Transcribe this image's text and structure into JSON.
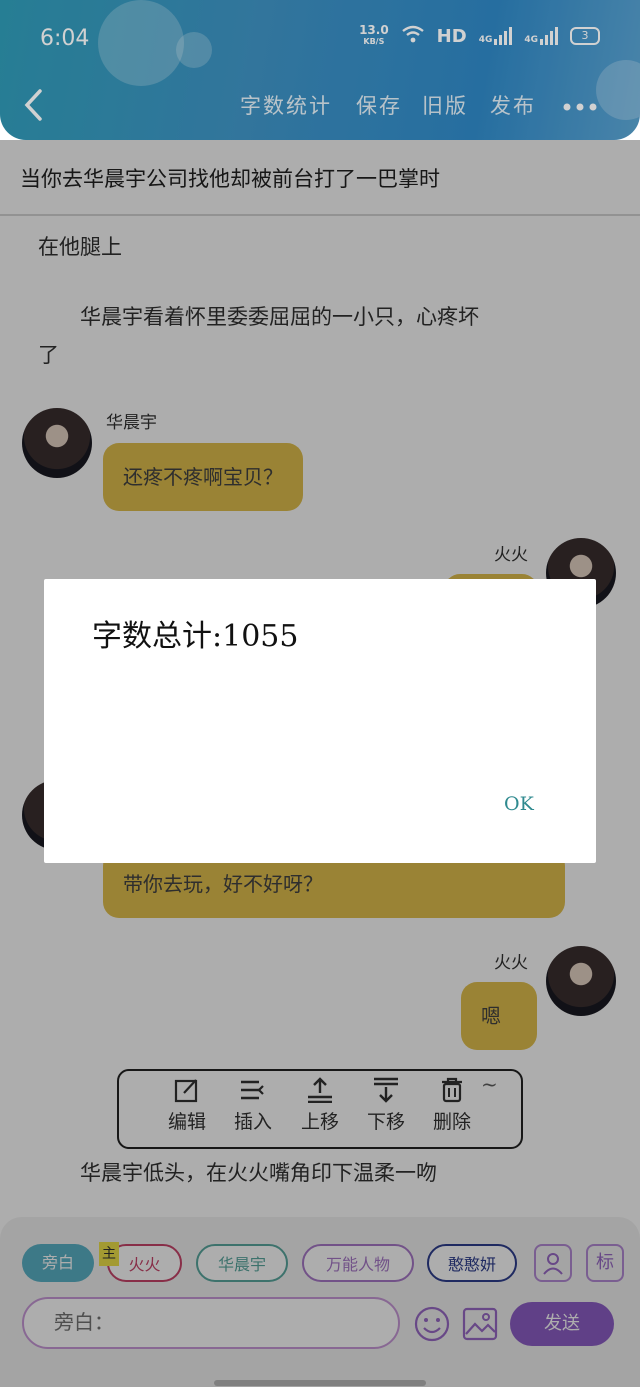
{
  "status_bar": {
    "time": "6:04",
    "net_speed": "13.0",
    "net_unit": "KB/S",
    "hd": "HD",
    "net1": "4G",
    "net2": "4G",
    "battery": "3"
  },
  "header": {
    "back_icon": "chevron-left-icon",
    "word_count": "字数统计",
    "save": "保存",
    "old_version": "旧版",
    "publish": "发布",
    "more_icon": "more-dots-icon"
  },
  "story": {
    "title": "当你去华晨宇公司找他却被前台打了一巴掌时",
    "para1_end": "在他腿上",
    "para2_line1": "华晨宇看着怀里委委屈屈的一小只，心疼坏",
    "para2_line2": "了",
    "closing": "华晨宇低头，在火火嘴角印下温柔一吻"
  },
  "chat": {
    "msg1_name": "华晨宇",
    "msg1_text": "还疼不疼啊宝贝？",
    "msg2_name": "火火",
    "msg3_text": "带你去玩，好不好呀？",
    "msg4_name": "火火",
    "msg4_text": "嗯~"
  },
  "dialog": {
    "text": "字数总计:1055",
    "ok": "OK"
  },
  "actions": {
    "edit": "编辑",
    "insert": "插入",
    "move_up": "上移",
    "move_down": "下移",
    "delete": "删除"
  },
  "bottom": {
    "chip_narration": "旁白",
    "main_badge": "主",
    "chip_huohuo": "火火",
    "chip_hcy": "华晨宇",
    "chip_universal": "万能人物",
    "chip_other": "憨憨妍",
    "tag_icon_label": "标",
    "input_placeholder": "旁白：",
    "send": "发送"
  },
  "colors": {
    "header_start": "#2f9ab5",
    "header_end": "#2f87c4",
    "bubble": "#e4c24f",
    "send": "#8e5fc7",
    "ok": "#2f8a8f"
  }
}
